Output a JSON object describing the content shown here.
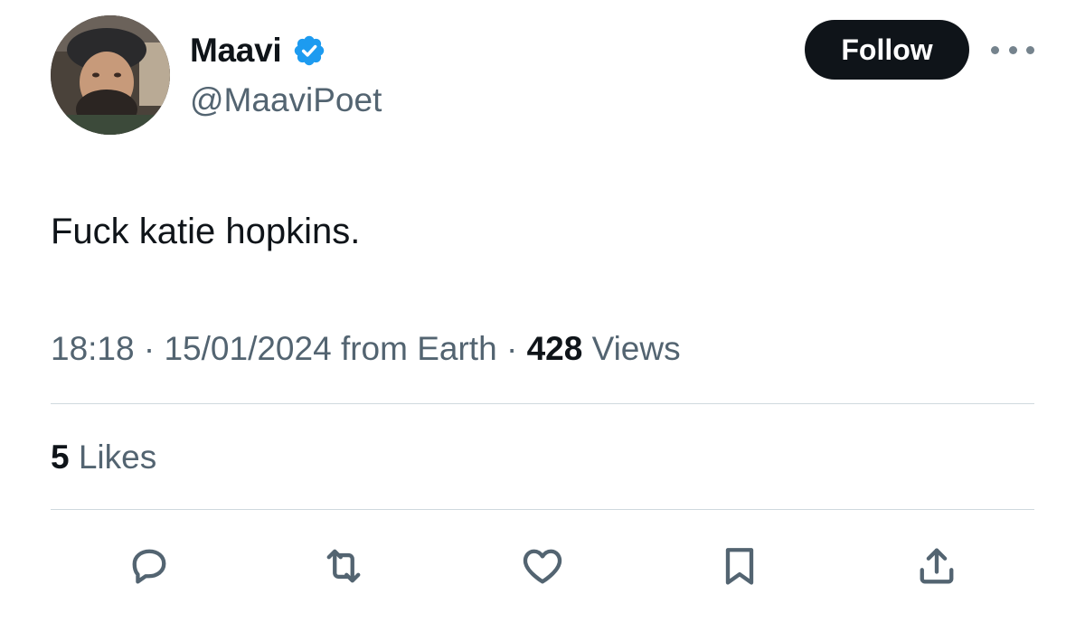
{
  "author": {
    "display_name": "Maavi",
    "handle": "@MaaviPoet",
    "verified": true,
    "avatar": "avatar-photo"
  },
  "header": {
    "follow_label": "Follow",
    "more_icon": "more-horizontal-icon"
  },
  "tweet": {
    "text": "Fuck katie hopkins."
  },
  "meta": {
    "time": "18:18",
    "separator": " · ",
    "date": "15/01/2024",
    "location": " from Earth",
    "views_count": "428",
    "views_label": " Views"
  },
  "stats": {
    "likes_count": "5",
    "likes_label": " Likes"
  },
  "actions": [
    {
      "icon": "reply-icon"
    },
    {
      "icon": "retweet-icon"
    },
    {
      "icon": "like-icon"
    },
    {
      "icon": "bookmark-icon"
    },
    {
      "icon": "share-icon"
    }
  ],
  "colors": {
    "text_primary": "#0f1419",
    "text_secondary": "#536471",
    "verified_blue": "#1d9bf0",
    "follow_bg": "#0f1419",
    "divider": "#cfd9de"
  }
}
